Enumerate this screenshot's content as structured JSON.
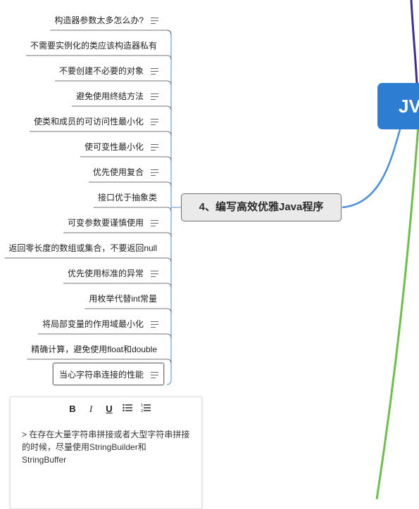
{
  "root": {
    "label": "JV"
  },
  "branch": {
    "title": "4、编写高效优雅Java程序"
  },
  "items": [
    {
      "label": "构造器参数太多怎么办?",
      "has_note": true
    },
    {
      "label": "不需要实例化的类应该构造器私有",
      "has_note": false
    },
    {
      "label": "不要创建不必要的对象",
      "has_note": true
    },
    {
      "label": "避免使用终结方法",
      "has_note": true
    },
    {
      "label": "使类和成员的可访问性最小化",
      "has_note": true
    },
    {
      "label": "使可变性最小化",
      "has_note": true
    },
    {
      "label": "优先使用复合",
      "has_note": true
    },
    {
      "label": "接口优于抽象类",
      "has_note": false
    },
    {
      "label": "可变参数要谨慎使用",
      "has_note": true
    },
    {
      "label": "返回零长度的数组或集合，不要返回null",
      "has_note": false
    },
    {
      "label": "优先使用标准的异常",
      "has_note": true
    },
    {
      "label": "用枚举代替int常量",
      "has_note": false
    },
    {
      "label": "将局部变量的作用域最小化",
      "has_note": true
    },
    {
      "label": "精确计算，避免使用float和double",
      "has_note": false
    },
    {
      "label": "当心字符串连接的性能",
      "has_note": true,
      "selected": true
    }
  ],
  "note_icon": "note-lines-icon",
  "editor": {
    "toolbar": {
      "bold": "B",
      "italic": "I",
      "underline": "U",
      "bullet_list": "bulleted-list-icon",
      "numbered_list": "numbered-list-icon"
    },
    "content": "> 在存在大量字符串拼接或者大型字符串拼接的时候，尽量使用StringBuilder和StringBuffer"
  },
  "colors": {
    "branch_line": "#4a8fdc",
    "root_fill": "#2d7dd2",
    "purple_line": "#3d2f9a",
    "green_line": "#6cc04a",
    "node_border": "#6f6f6f"
  }
}
